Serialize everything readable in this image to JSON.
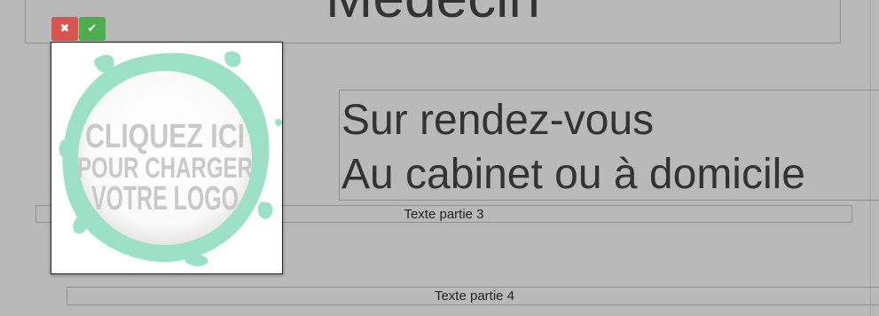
{
  "header": {
    "title": "Médecin"
  },
  "subtitle": {
    "line1": "Sur rendez-vous",
    "line2": "Au cabinet ou à domicile"
  },
  "parts": {
    "part3": "Texte partie 3",
    "part4": "Texte partie 4"
  },
  "logo_editor": {
    "cancel_icon": "close-icon",
    "confirm_icon": "check-icon",
    "cancel_glyph": "✖",
    "confirm_glyph": "✔",
    "placeholder_lines": [
      "CLIQUEZ ICI",
      "POUR CHARGER",
      "VOTRE LOGO"
    ]
  },
  "colors": {
    "cancel": "#d9534f",
    "confirm": "#4cae4c",
    "splash": "#9de0c8"
  }
}
